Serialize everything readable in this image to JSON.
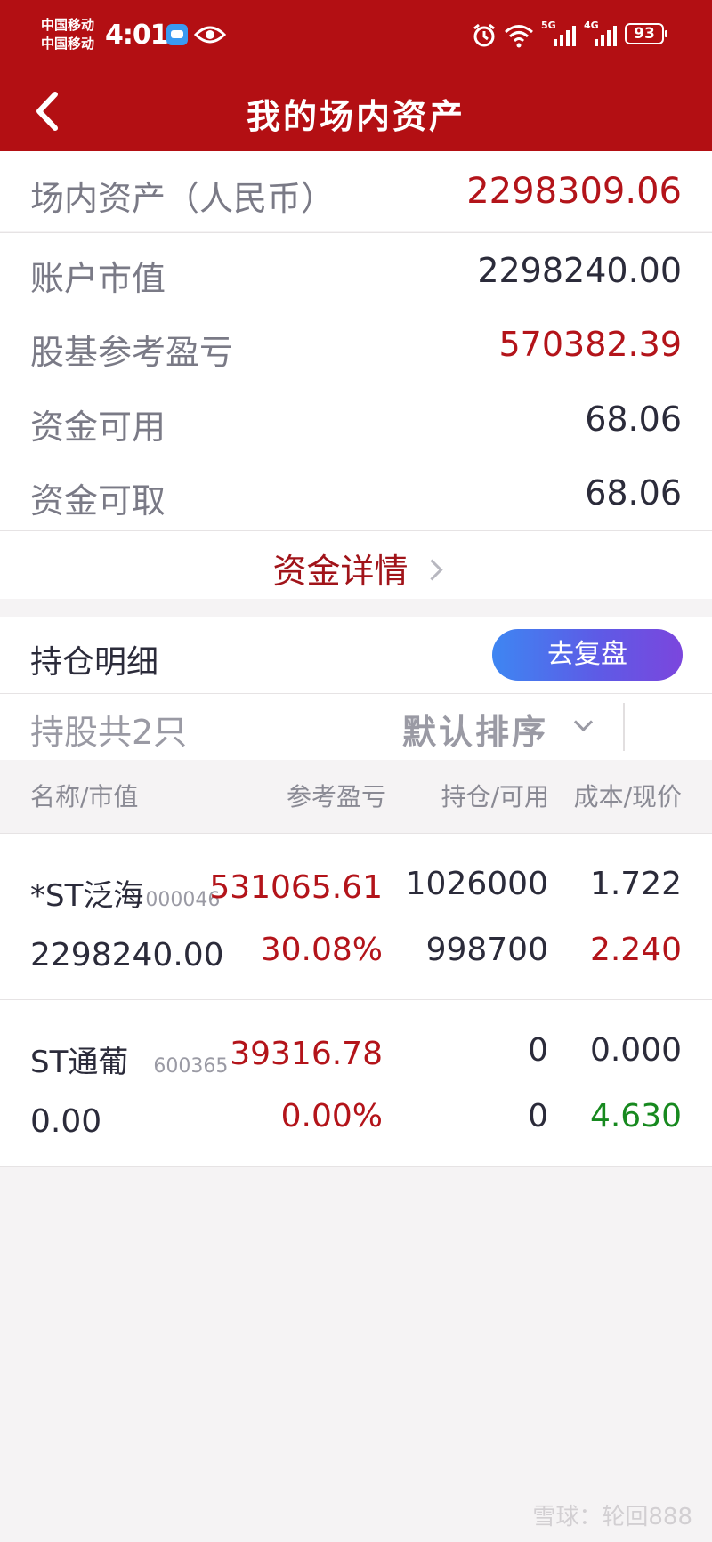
{
  "status": {
    "carrier1": "中国移动",
    "carrier2": "中国移动",
    "time": "4:01",
    "net1": "5G",
    "net2": "4G",
    "battery": "93"
  },
  "nav": {
    "title": "我的场内资产"
  },
  "assets": {
    "total_label": "场内资产（人民币）",
    "total_value": "2298309.06",
    "market_value_label": "账户市值",
    "market_value": "2298240.00",
    "pnl_label": "股基参考盈亏",
    "pnl_value": "570382.39",
    "available_label": "资金可用",
    "available_value": "68.06",
    "withdrawable_label": "资金可取",
    "withdrawable_value": "68.06",
    "detail_link": "资金详情"
  },
  "holdings": {
    "title": "持仓明细",
    "review_button": "去复盘",
    "count_label": "持股共2只",
    "sort_label": "默认排序",
    "columns": [
      "名称/市值",
      "参考盈亏",
      "持仓/可用",
      "成本/现价"
    ],
    "rows": [
      {
        "name": "*ST泛海",
        "code": "000046",
        "market_value": "2298240.00",
        "pnl": "531065.61",
        "pnl_pct": "30.08%",
        "position": "1026000",
        "available": "998700",
        "cost": "1.722",
        "price": "2.240"
      },
      {
        "name": "ST通葡",
        "code": "600365",
        "market_value": "0.00",
        "pnl": "39316.78",
        "pnl_pct": "0.00%",
        "position": "0",
        "available": "0",
        "cost": "0.000",
        "price": "4.630"
      }
    ]
  },
  "watermark": "雪球：轮回888"
}
